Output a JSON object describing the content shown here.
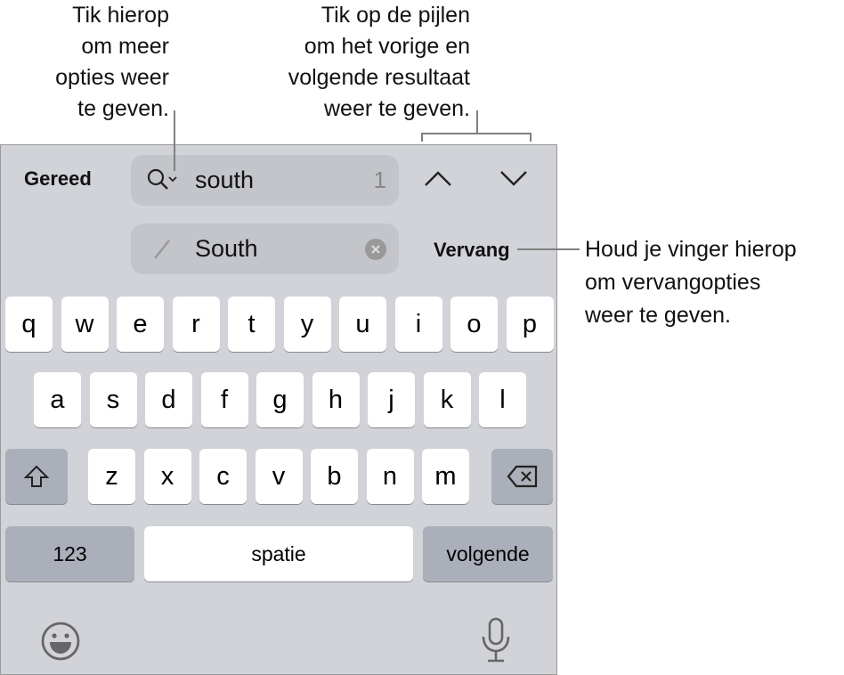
{
  "callouts": {
    "options": "Tik hierop\nom meer\nopties weer\nte geven.",
    "arrows": "Tik op de pijlen\nom het vorige en\nvolgende resultaat\nweer te geven.",
    "replace": "Houd je vinger hierop\nom vervangopties\nweer te geven."
  },
  "toolbar": {
    "done": "Gereed",
    "search_value": "south",
    "match_count": "1",
    "replace_value": "South",
    "replace_button": "Vervang"
  },
  "keyboard": {
    "row1": [
      "q",
      "w",
      "e",
      "r",
      "t",
      "y",
      "u",
      "i",
      "o",
      "p"
    ],
    "row2": [
      "a",
      "s",
      "d",
      "f",
      "g",
      "h",
      "j",
      "k",
      "l"
    ],
    "row3": [
      "z",
      "x",
      "c",
      "v",
      "b",
      "n",
      "m"
    ],
    "numbers": "123",
    "space": "spatie",
    "next": "volgende"
  },
  "icons": [
    "search-icon",
    "chevron-up-icon",
    "chevron-down-icon",
    "pencil-icon",
    "clear-icon",
    "shift-icon",
    "delete-icon",
    "emoji-icon",
    "microphone-icon"
  ]
}
